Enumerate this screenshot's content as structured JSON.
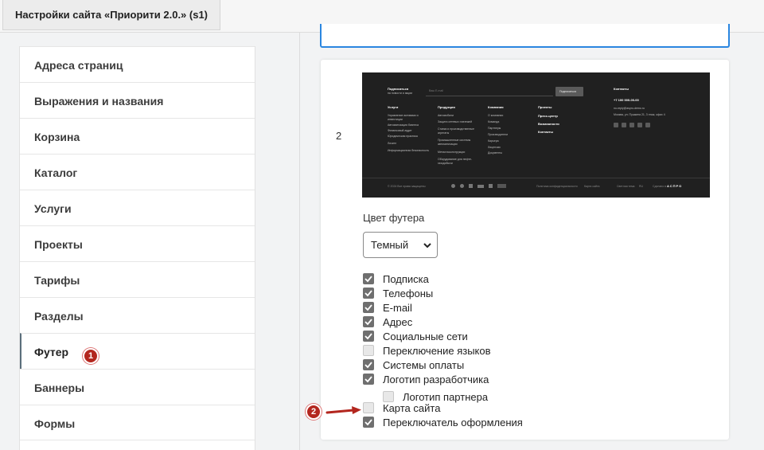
{
  "window": {
    "tab_title": "Настройки сайта «Приорити 2.0.» (s1)"
  },
  "sidebar": {
    "items": [
      {
        "label": "Адреса страниц"
      },
      {
        "label": "Выражения и названия"
      },
      {
        "label": "Корзина"
      },
      {
        "label": "Каталог"
      },
      {
        "label": "Услуги"
      },
      {
        "label": "Проекты"
      },
      {
        "label": "Тарифы"
      },
      {
        "label": "Разделы"
      },
      {
        "label": "Футер"
      },
      {
        "label": "Баннеры"
      },
      {
        "label": "Формы"
      }
    ],
    "active": "Футер"
  },
  "annotations": {
    "badge1": "1",
    "badge2": "2"
  },
  "footer_settings": {
    "option_number": "2",
    "color_label": "Цвет футера",
    "color_value": "Темный",
    "checkboxes": [
      {
        "label": "Подписка",
        "checked": true
      },
      {
        "label": "Телефоны",
        "checked": true
      },
      {
        "label": "E-mail",
        "checked": true
      },
      {
        "label": "Адрес",
        "checked": true
      },
      {
        "label": "Социальные сети",
        "checked": true
      },
      {
        "label": "Переключение языков",
        "checked": false
      },
      {
        "label": "Системы оплаты",
        "checked": true
      },
      {
        "label": "Логотип разработчика",
        "checked": true
      },
      {
        "label": "Логотип партнера",
        "checked": false
      },
      {
        "label": "Карта сайта",
        "checked": false
      },
      {
        "label": "Переключатель оформления",
        "checked": true
      }
    ]
  },
  "preview": {
    "subscribe_line1": "Подписаться",
    "subscribe_line2": "на новости и акции",
    "email_placeholder": "Ваш E-mail",
    "subscribe_button": "Подписаться",
    "contacts_title": "Контакты",
    "phone": "+7 100 000-00-00",
    "email": "no-reply@aspro-demo.ru",
    "address": "Москва, ул. Пушкина 21, 3 этаж, офис 4",
    "col_services": "Услуги",
    "col_services_items": [
      "Управление активами и",
      "инвестиции",
      "Автоматизация бизнеса",
      "Финансовый аудит",
      "Юридическая практика",
      "Лизинг",
      "Информационная безопасность"
    ],
    "col_products": "Продукция",
    "col_products_items": [
      "Автомобили",
      "Защита сетевых платежей",
      "Станки и производственные",
      "агрегаты",
      "Промышленные системы",
      "автоматизации",
      "Металлоконструкции",
      "Оборудование для нефте-",
      "газодобычи"
    ],
    "col_company": "Компания",
    "col_company_items": [
      "О компании",
      "Команда",
      "Партнеры",
      "Производители",
      "Карьера",
      "Лицензии",
      "Документы"
    ],
    "col_projects": [
      "Проекты",
      "Пресс-центр",
      "Возможности",
      "Контакты"
    ],
    "copyright": "© 2024 Все права защищены",
    "privacy": "Политика конфиденциальности",
    "sitemap": "Карта сайта",
    "theme": "Светлая тема",
    "lang": "RU",
    "made_by": "Сделано в",
    "aspro": "АСПРО"
  }
}
